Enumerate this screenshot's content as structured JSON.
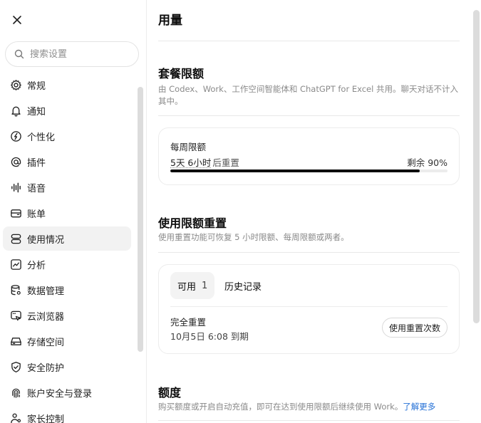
{
  "sidebar": {
    "search_placeholder": "搜索设置",
    "items": [
      {
        "label": "常规",
        "icon": "gear-icon"
      },
      {
        "label": "通知",
        "icon": "bell-icon"
      },
      {
        "label": "个性化",
        "icon": "personalize-icon"
      },
      {
        "label": "插件",
        "icon": "at-sign-icon"
      },
      {
        "label": "语音",
        "icon": "voice-waveform-icon"
      },
      {
        "label": "账单",
        "icon": "wallet-icon"
      },
      {
        "label": "使用情况",
        "icon": "usage-stack-icon",
        "active": true
      },
      {
        "label": "分析",
        "icon": "analytics-chart-icon"
      },
      {
        "label": "数据管理",
        "icon": "database-icon"
      },
      {
        "label": "云浏览器",
        "icon": "cloud-browser-icon"
      },
      {
        "label": "存储空间",
        "icon": "storage-drive-icon"
      },
      {
        "label": "安全防护",
        "icon": "shield-check-icon"
      },
      {
        "label": "账户安全与登录",
        "icon": "fingerprint-icon"
      },
      {
        "label": "家长控制",
        "icon": "parental-control-icon"
      }
    ]
  },
  "main": {
    "page_title": "用量",
    "plan": {
      "title": "套餐限额",
      "description": "由 Codex、Work、工作空间智能体和 ChatGPT for Excel 共用。聊天对话不计入其中。",
      "weekly": {
        "label": "每周限额",
        "reset_time": "5天 6小时",
        "reset_suffix": "后重置",
        "remaining_text": "剩余 90%",
        "used_fraction": 0.9
      }
    },
    "reset": {
      "title": "使用限额重置",
      "description": "使用重置功能可恢复 5 小时限额、每周限额或两者。",
      "tab_available_label": "可用",
      "tab_available_count": "1",
      "tab_history_label": "历史记录",
      "item_name": "完全重置",
      "item_expiry": "10月5日 6:08 到期",
      "use_button": "使用重置次数"
    },
    "credits": {
      "title": "额度",
      "description": "购买额度或开启自动充值，即可在达到使用限额后继续使用 Work。",
      "learn_more": "了解更多"
    }
  },
  "colors": {
    "accent_link": "#2470d6",
    "progress_fill": "#0d0d0d",
    "active_bg": "#f2f2f2"
  }
}
